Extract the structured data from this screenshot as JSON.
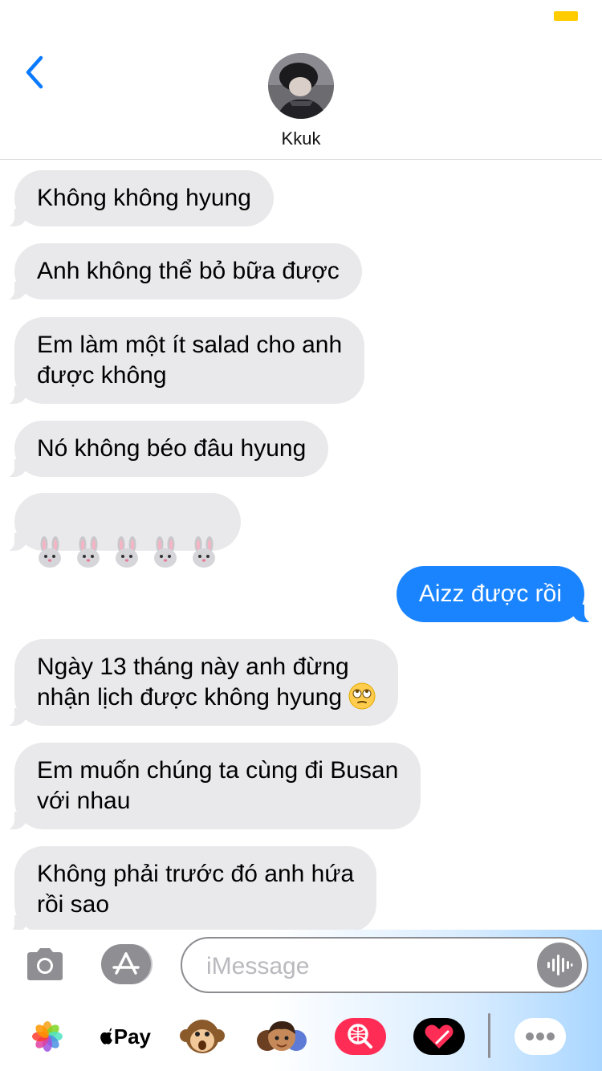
{
  "header": {
    "contact_name": "Kkuk"
  },
  "messages": [
    {
      "direction": "incoming",
      "text": "Không không hyung"
    },
    {
      "direction": "incoming",
      "text": "Anh không thể bỏ bữa được"
    },
    {
      "direction": "incoming",
      "text": "Em làm một ít salad cho anh\nđược không"
    },
    {
      "direction": "incoming",
      "text": "Nó không béo đâu hyung"
    },
    {
      "direction": "incoming",
      "text": "",
      "emoji": "rabbit-face-icon",
      "emoji_count": 5
    },
    {
      "direction": "outgoing",
      "text": "Aizz được rồi"
    },
    {
      "direction": "incoming",
      "text": "Ngày 13 tháng này anh đừng\nnhận lịch được không hyung",
      "emoji": "eye-roll-emoji-icon"
    },
    {
      "direction": "incoming",
      "text": "Em muốn chúng ta cùng đi Busan\nvới nhau"
    },
    {
      "direction": "incoming",
      "text": "Không phải trước đó anh hứa\nrồi sao"
    }
  ],
  "input": {
    "placeholder": "iMessage",
    "value": ""
  },
  "app_tray": {
    "apple_pay_label": "Pay",
    "icons": [
      "photos-icon",
      "apple-pay-icon",
      "monkey-animoji-icon",
      "memoji-icon",
      "image-search-icon",
      "digital-touch-heart-icon",
      "more-apps-icon"
    ]
  },
  "colors": {
    "incoming_bubble": "#e9e9eb",
    "outgoing_bubble": "#1a84ff",
    "accent": "#0a7aff",
    "battery": "#ffcc00"
  }
}
